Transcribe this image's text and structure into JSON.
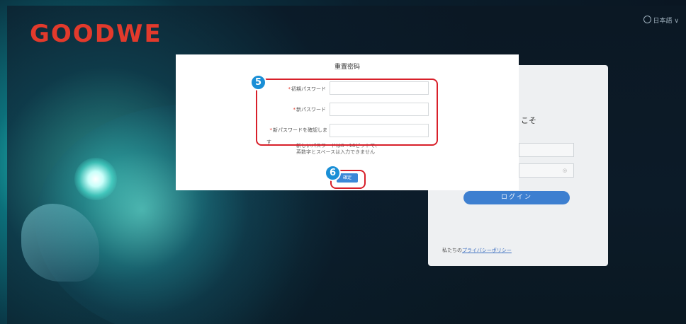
{
  "brand": {
    "logo_text": "GOODWE"
  },
  "language": {
    "label": "日本語 ∨"
  },
  "login": {
    "welcome_fragment": "こそ",
    "login_button": "ログイン",
    "privacy_prefix": "私たちの",
    "privacy_link": "プライバシーポリシー"
  },
  "reset_dialog": {
    "title": "重置密码",
    "fields": [
      {
        "label": "初期パスワード",
        "required": "*"
      },
      {
        "label": "新パスワード",
        "required": "*"
      },
      {
        "label": "新パスワードを確認しま",
        "label_wrap": "す",
        "required": "*"
      }
    ],
    "hint_line1": "新しいパスワードは8～16ビットで、",
    "hint_line2": "英数字とスペースは入力できません",
    "confirm_button": "確定"
  },
  "annotations": {
    "step5": "5",
    "step6": "6"
  },
  "colors": {
    "brand_red": "#e23a2c",
    "annotation_red": "#d8202a",
    "annotation_blue": "#1a8fd6",
    "primary_blue": "#3b88d8"
  }
}
